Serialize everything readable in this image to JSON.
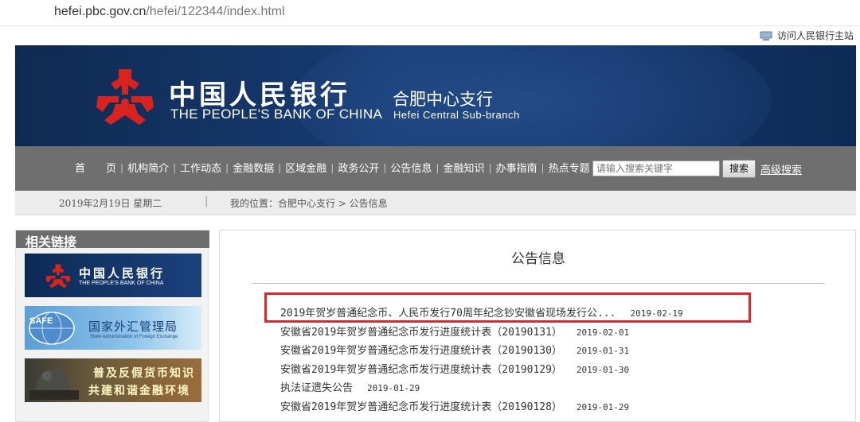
{
  "browser": {
    "url_host": "hefei.pbc.gov.cn",
    "url_path": "/hefei/122344/index.html"
  },
  "header": {
    "top_link": "访问人民银行主站",
    "bank_name_cn": "中国人民银行",
    "bank_name_en": "THE PEOPLE'S BANK OF CHINA",
    "branch_cn": "合肥中心支行",
    "branch_en": "Hefei  Central  Sub-branch",
    "logo_color": "#d9231f"
  },
  "nav": {
    "items": [
      "首　　页",
      "机构简介",
      "工作动态",
      "金融数据",
      "区域金融",
      "政务公开",
      "公告信息",
      "金融知识",
      "办事指南",
      "热点专题"
    ],
    "search_placeholder": "请输入搜索关键字",
    "search_button": "搜索",
    "advanced_search": "高级搜索"
  },
  "breadcrumb": {
    "date": "2019年2月19日  星期二",
    "divider": "|",
    "location": "我的位置：合肥中心支行  >  公告信息"
  },
  "sidebar": {
    "title": "相关链接",
    "links": [
      {
        "cn": "中国人民银行",
        "en": "THE PEOPLE'S BANK OF CHINA"
      },
      {
        "badge": "SAFE",
        "cn": "国家外汇管理局",
        "en": "State Administration of Foreign Exchange"
      },
      {
        "line1": "普及反假货币知识",
        "line2": "共建和谐金融环境"
      }
    ]
  },
  "main": {
    "title": "公告信息",
    "notices": [
      {
        "title": "2019年贺岁普通纪念币、人民币发行70周年纪念钞安徽省现场发行公...",
        "date": "2019-02-19"
      },
      {
        "title": "安徽省2019年贺岁普通纪念币发行进度统计表（20190131）",
        "date": "2019-02-01"
      },
      {
        "title": "安徽省2019年贺岁普通纪念币发行进度统计表（20190130）",
        "date": "2019-01-31"
      },
      {
        "title": "安徽省2019年贺岁普通纪念币发行进度统计表（20190129）",
        "date": "2019-01-30"
      },
      {
        "title": "执法证遗失公告",
        "date": "2019-01-29"
      },
      {
        "title": "安徽省2019年贺岁普通纪念币发行进度统计表（20190128）",
        "date": "2019-01-29"
      }
    ],
    "highlight_color": "#e0272d"
  }
}
